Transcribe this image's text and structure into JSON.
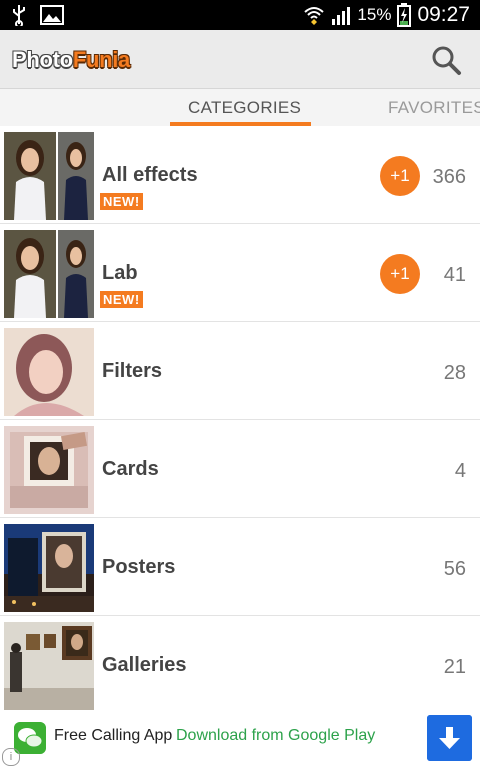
{
  "status_bar": {
    "battery_percent": "15%",
    "time": "09:27"
  },
  "app_bar": {
    "logo_part1": "Photo",
    "logo_part2": "Funia",
    "search_icon": "search-icon"
  },
  "tabs": [
    {
      "label": "CATEGORIES",
      "active": true
    },
    {
      "label": "FAVORITES",
      "active": false
    }
  ],
  "categories": [
    {
      "label": "All effects",
      "badge": "NEW!",
      "plus_badge": "+1",
      "count": "366"
    },
    {
      "label": "Lab",
      "badge": "NEW!",
      "plus_badge": "+1",
      "count": "41"
    },
    {
      "label": "Filters",
      "count": "28"
    },
    {
      "label": "Cards",
      "count": "4"
    },
    {
      "label": "Posters",
      "count": "56"
    },
    {
      "label": "Galleries",
      "count": "21"
    }
  ],
  "ad": {
    "title": "Free Calling App",
    "link": "Download from Google Play",
    "icon": "chat-icon",
    "download_icon": "download-arrow-icon",
    "info_icon": "info-icon"
  },
  "colors": {
    "accent": "#f47b20",
    "ad_link": "#2da24b",
    "ad_button": "#1e6be0"
  }
}
